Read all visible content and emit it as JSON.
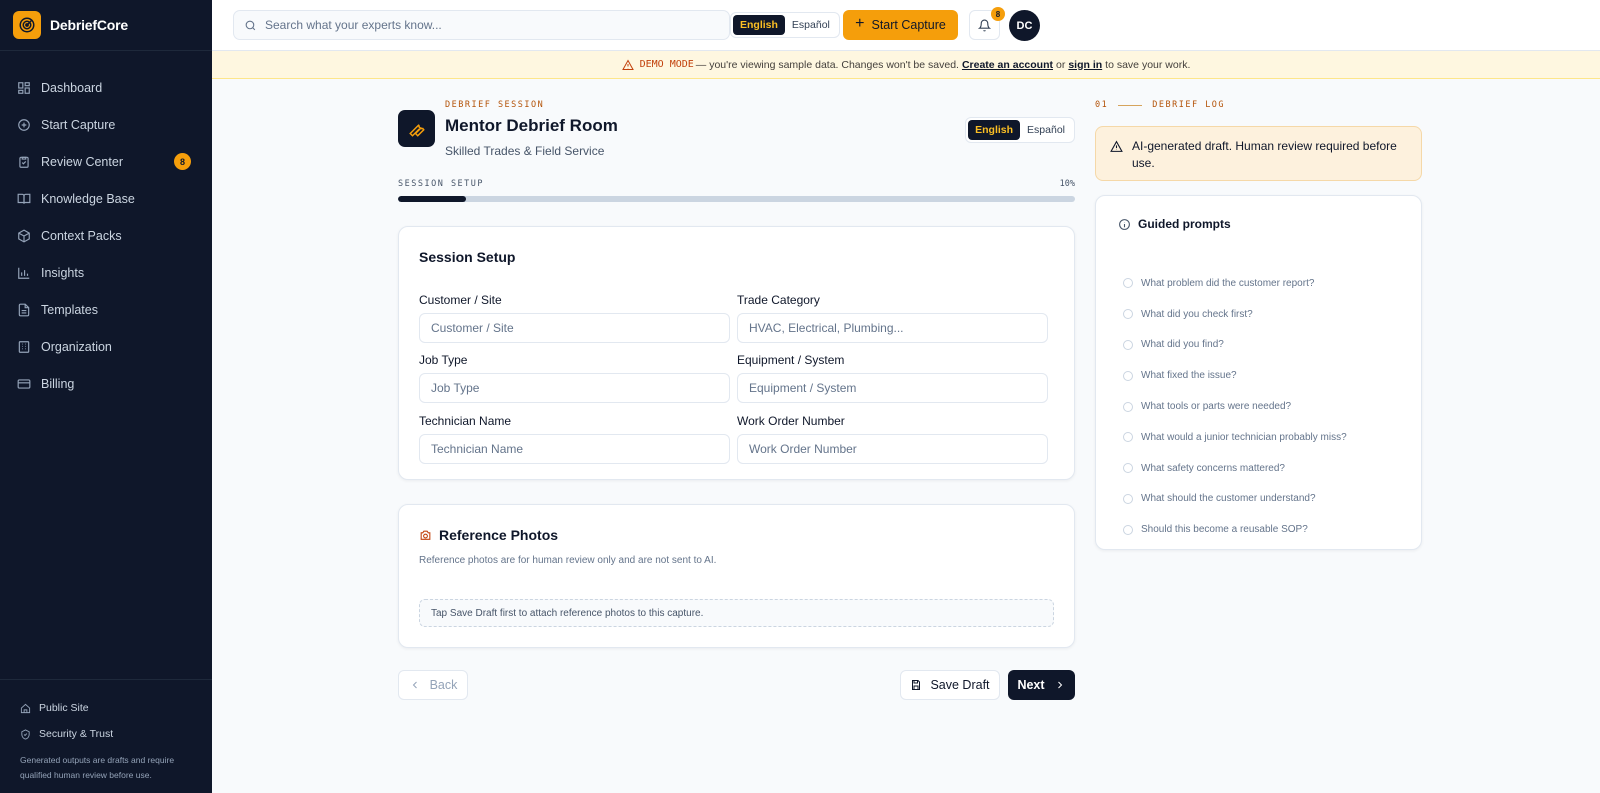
{
  "app": {
    "name": "DebriefCore"
  },
  "sidebar": {
    "items": [
      {
        "label": "Dashboard",
        "icon": "dashboard-icon"
      },
      {
        "label": "Start Capture",
        "icon": "plus-circle-icon"
      },
      {
        "label": "Review Center",
        "icon": "clipboard-check-icon",
        "badge": "8"
      },
      {
        "label": "Knowledge Base",
        "icon": "book-icon"
      },
      {
        "label": "Context Packs",
        "icon": "box-icon"
      },
      {
        "label": "Insights",
        "icon": "bar-chart-icon"
      },
      {
        "label": "Templates",
        "icon": "file-icon"
      },
      {
        "label": "Organization",
        "icon": "building-icon"
      },
      {
        "label": "Billing",
        "icon": "credit-card-icon"
      }
    ],
    "footer": {
      "public_site": "Public Site",
      "security": "Security & Trust",
      "note": "Generated outputs are drafts and require qualified human review before use."
    }
  },
  "topbar": {
    "search_placeholder": "Search what your experts know...",
    "lang_english": "English",
    "lang_spanish": "Español",
    "start_capture": "Start Capture",
    "notification_count": "8",
    "avatar_initials": "DC"
  },
  "banner": {
    "tag": "DEMO MODE",
    "text_before": "— you're viewing sample data. Changes won't be saved.",
    "create_account": "Create an account",
    "or": "or",
    "sign_in": "sign in",
    "text_after": "to save your work."
  },
  "session": {
    "eyebrow": "DEBRIEF SESSION",
    "title": "Mentor Debrief Room",
    "subtitle": "Skilled Trades & Field Service",
    "lang_english": "English",
    "lang_spanish": "Español"
  },
  "progress": {
    "label": "SESSION SETUP",
    "percent_text": "10%",
    "value": 10
  },
  "setup": {
    "title": "Session Setup",
    "fields": {
      "customer": {
        "label": "Customer / Site",
        "placeholder": "Customer / Site"
      },
      "trade": {
        "label": "Trade Category",
        "placeholder": "HVAC, Electrical, Plumbing..."
      },
      "job": {
        "label": "Job Type",
        "placeholder": "Job Type"
      },
      "equipment": {
        "label": "Equipment / System",
        "placeholder": "Equipment / System"
      },
      "technician": {
        "label": "Technician Name",
        "placeholder": "Technician Name"
      },
      "work_order": {
        "label": "Work Order Number",
        "placeholder": "Work Order Number"
      }
    }
  },
  "photos": {
    "title": "Reference Photos",
    "note": "Reference photos are for human review only and are not sent to AI.",
    "drop_text": "Tap Save Draft first to attach reference photos to this capture."
  },
  "actions": {
    "back": "Back",
    "save_draft": "Save Draft",
    "next": "Next"
  },
  "log": {
    "number": "01",
    "label": "DEBRIEF LOG",
    "notice": "AI-generated draft. Human review required before use."
  },
  "prompts": {
    "title": "Guided prompts",
    "items": [
      "What problem did the customer report?",
      "What did you check first?",
      "What did you find?",
      "What fixed the issue?",
      "What tools or parts were needed?",
      "What would a junior technician probably miss?",
      "What safety concerns mattered?",
      "What should the customer understand?",
      "Should this become a reusable SOP?"
    ]
  }
}
